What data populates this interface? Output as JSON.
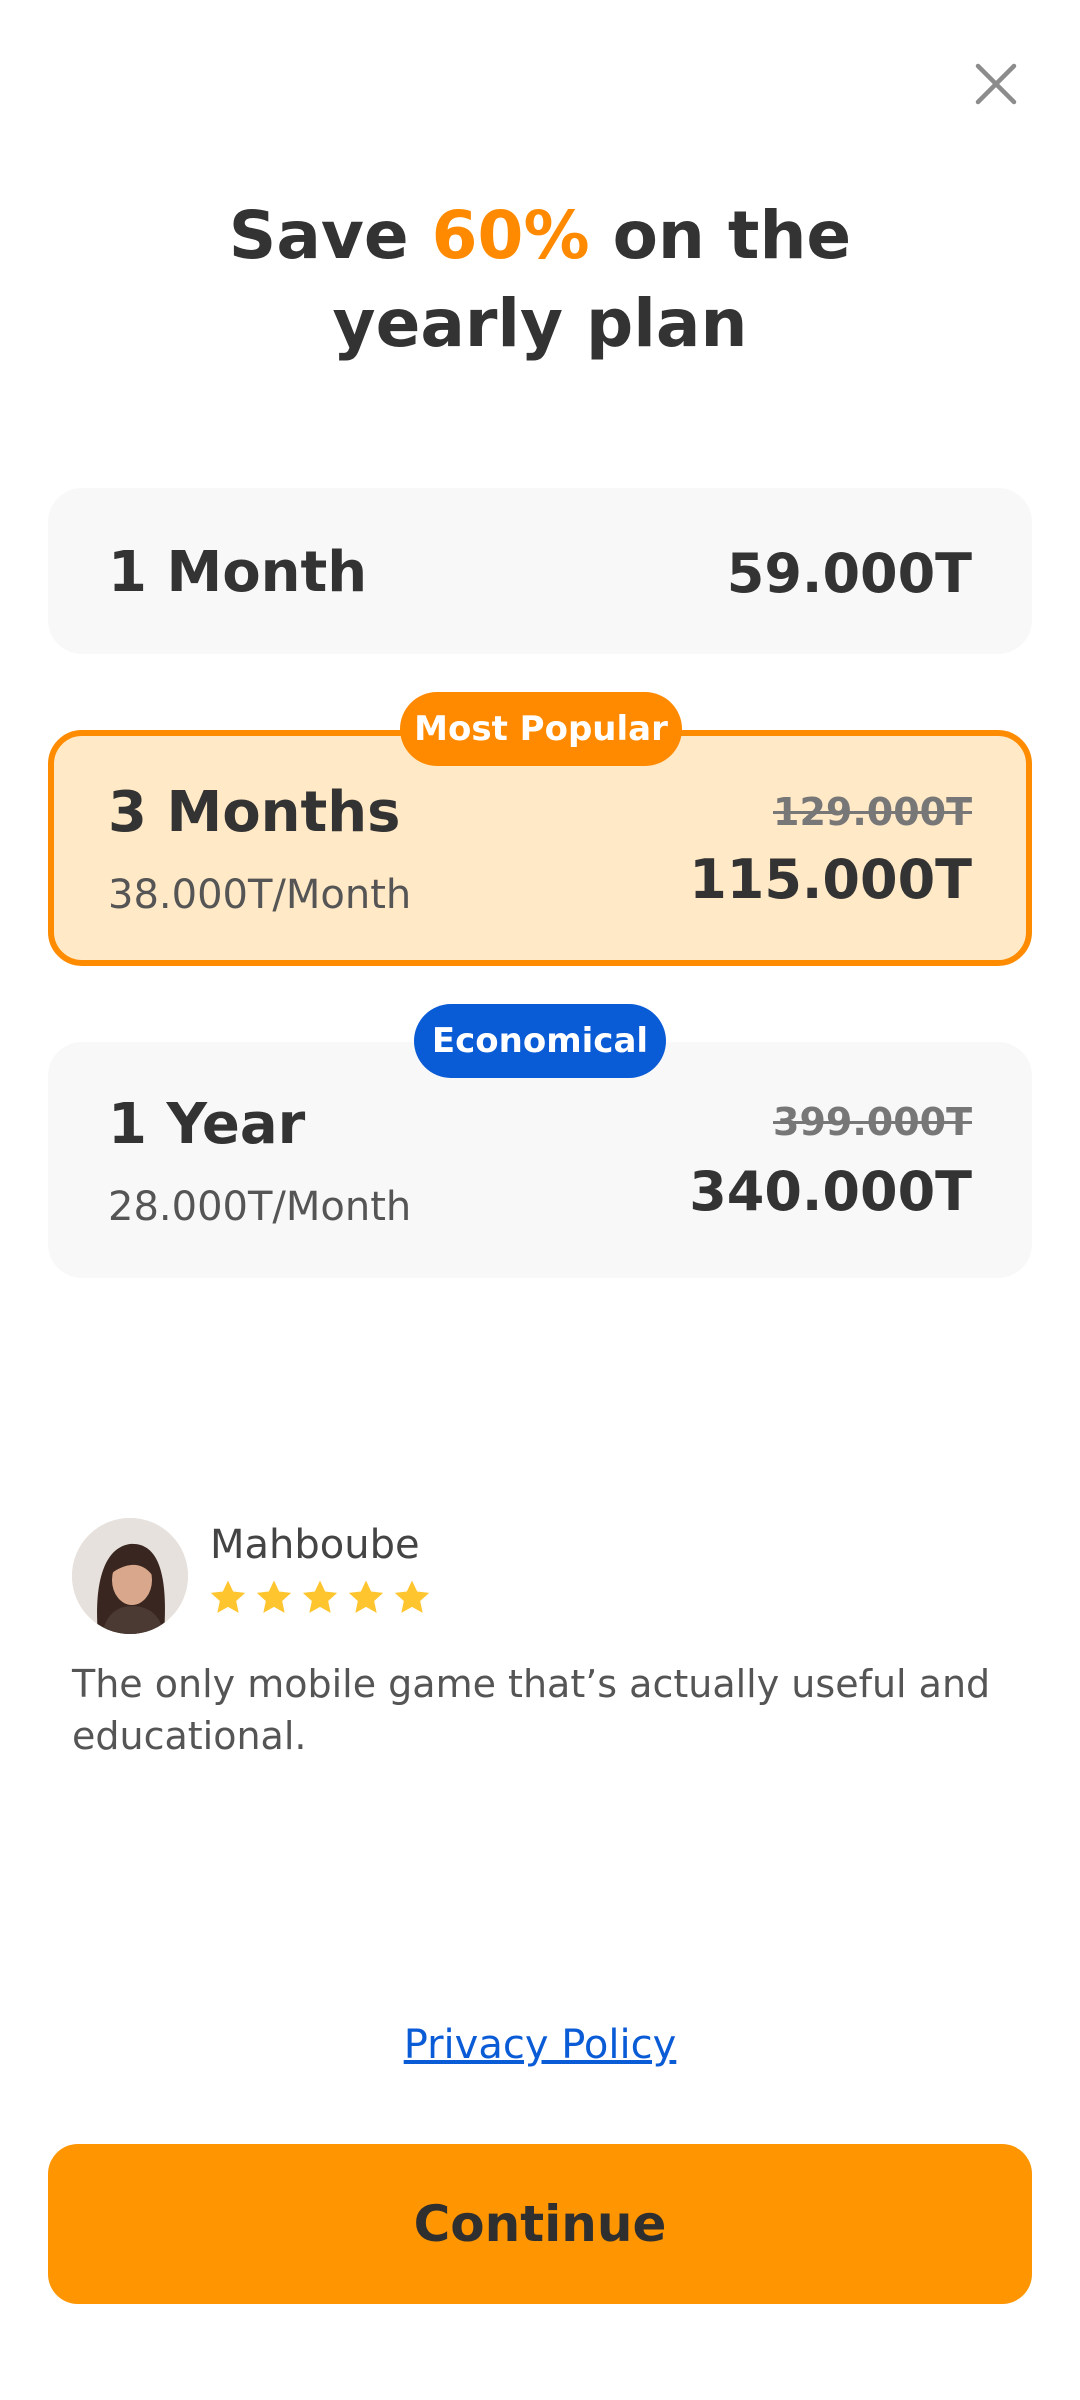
{
  "header": {
    "close_icon": "close-icon",
    "headline_prefix": "Save ",
    "headline_accent": "60%",
    "headline_suffix": " on the",
    "headline_line2": "yearly plan"
  },
  "colors": {
    "accent": "#ff8a00",
    "selected_bg": "#ffe9c6",
    "economical_badge": "#0a5bd6",
    "link": "#0a5bd6",
    "cta": "#ff9500"
  },
  "plans": [
    {
      "name": "1 Month",
      "price": "59.000T",
      "selected": false
    },
    {
      "badge": "Most Popular",
      "name": "3 Months",
      "per_month": "38.000T/Month",
      "old_price": "129.000T",
      "price": "115.000T",
      "selected": true
    },
    {
      "badge": "Economical",
      "name": "1 Year",
      "per_month": "28.000T/Month",
      "old_price": "399.000T",
      "price": "340.000T",
      "selected": false
    }
  ],
  "review": {
    "name": "Mahboube",
    "rating": 5,
    "text": "The only mobile game that’s actually useful and educational."
  },
  "footer": {
    "privacy_label": "Privacy Policy",
    "continue_label": "Continue"
  }
}
